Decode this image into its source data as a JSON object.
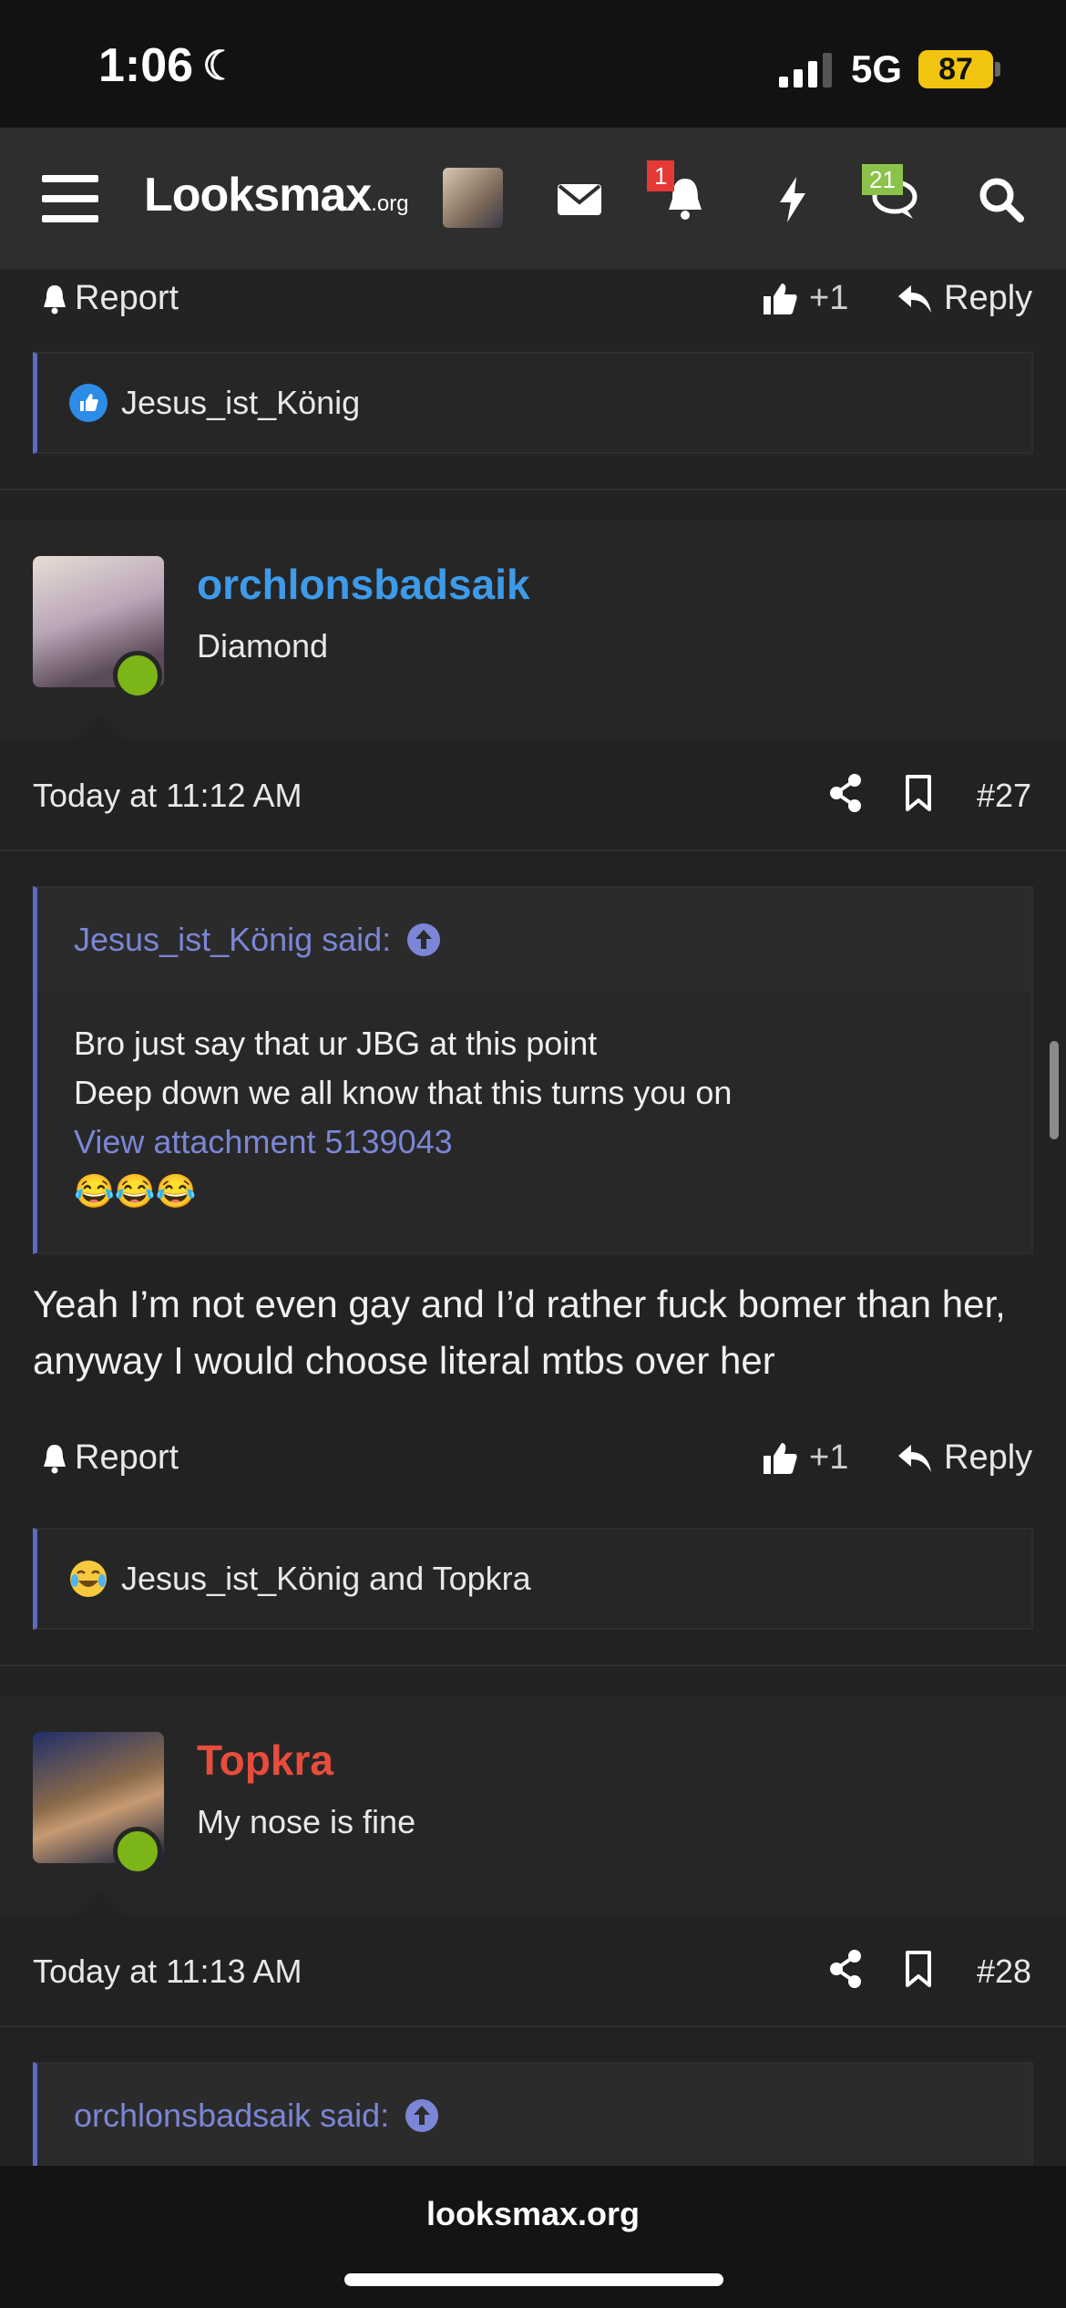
{
  "status_bar": {
    "time": "1:06",
    "network": "5G",
    "battery": "87"
  },
  "navbar": {
    "logo_main": "Looksmax",
    "logo_suffix": ".org",
    "alerts_badge": "1",
    "conversations_badge": "21",
    "colors": {
      "alerts_badge": "#e53935",
      "conversations_badge": "#8bc34a"
    }
  },
  "prev_post": {
    "report_label": "Report",
    "like_label": "+1",
    "reply_label": "Reply",
    "reactions": "Jesus_ist_König"
  },
  "post27": {
    "username": "orchlonsbadsaik",
    "user_title": "Diamond",
    "username_color": "#3d9be9",
    "date": "Today at 11:12 AM",
    "number": "#27",
    "quote": {
      "author": "Jesus_ist_König said:",
      "line1": "Bro just say that ur JBG at this point",
      "line2": "Deep down we all know that this turns you on",
      "attachment": "View attachment 5139043",
      "emojis": "😂😂😂"
    },
    "body": "Yeah I’m not even gay and I’d rather fuck bomer than her, anyway I would choose literal mtbs over her",
    "report_label": "Report",
    "like_label": "+1",
    "reply_label": "Reply",
    "reactions": "Jesus_ist_König and Topkra"
  },
  "post28": {
    "username": "Topkra",
    "user_title": "My nose is fine",
    "username_color": "#e74c3c",
    "date": "Today at 11:13 AM",
    "number": "#28",
    "quote_author": "orchlonsbadsaik said:"
  },
  "url_bar": {
    "url": "looksmax.org"
  }
}
